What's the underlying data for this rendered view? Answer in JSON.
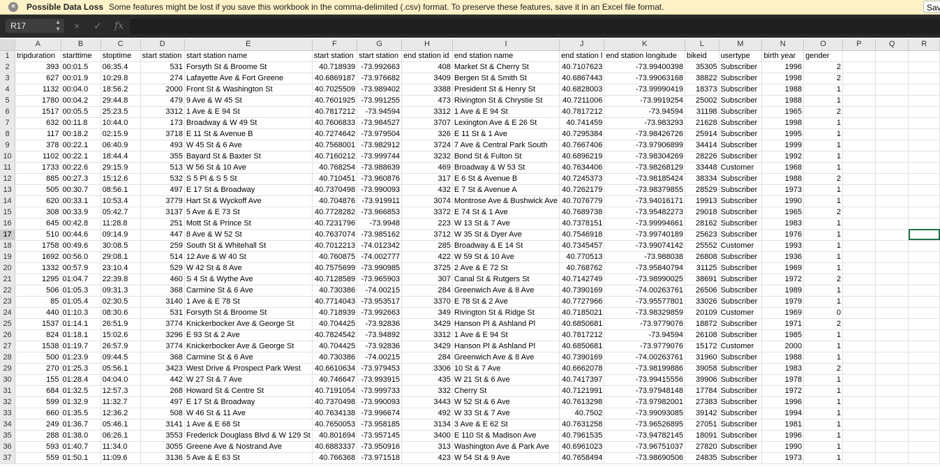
{
  "warning": {
    "icon": "close-circle-icon",
    "title": "Possible Data Loss",
    "message": "Some features might be lost if you save this workbook in the comma-delimited (.csv) format. To preserve these features, save it in an Excel file format.",
    "save_label": "Save As..."
  },
  "formula_bar": {
    "cell_ref": "R17",
    "cancel_icon": "×",
    "confirm_icon": "✓",
    "fx_label": "fx",
    "formula": ""
  },
  "sheet": {
    "selected_cell": "R17",
    "selected_row": "17",
    "columns": [
      "A",
      "B",
      "C",
      "D",
      "E",
      "F",
      "G",
      "H",
      "I",
      "J",
      "K",
      "L",
      "M",
      "N",
      "O",
      "P",
      "Q",
      "R"
    ],
    "rows": [
      [
        "tripduration",
        "starttime",
        "stoptime",
        "start station",
        "start station name",
        "start station",
        "start station",
        "end station id",
        "end station name",
        "end station l",
        "end station longitude",
        "bikeid",
        "usertype",
        "birth year",
        "gender",
        "",
        ""
      ],
      [
        "393",
        "00:01.5",
        "06:35.4",
        "531",
        "Forsyth St & Broome St",
        "40.718939",
        "-73.992663",
        "408",
        "Market St & Cherry St",
        "40.7107623",
        "-73.99400398",
        "35305",
        "Subscriber",
        "1996",
        "2",
        "",
        ""
      ],
      [
        "627",
        "00:01.9",
        "10:29.8",
        "274",
        "Lafayette Ave & Fort Greene",
        "40.6869187",
        "-73.976682",
        "3409",
        "Bergen St & Smith St",
        "40.6867443",
        "-73.99063168",
        "38822",
        "Subscriber",
        "1998",
        "2",
        "",
        ""
      ],
      [
        "1132",
        "00:04.0",
        "18:56.2",
        "2000",
        "Front St & Washington St",
        "40.7025509",
        "-73.989402",
        "3388",
        "President St & Henry St",
        "40.6828003",
        "-73.99990419",
        "18373",
        "Subscriber",
        "1988",
        "1",
        "",
        ""
      ],
      [
        "1780",
        "00:04.2",
        "29:44.8",
        "479",
        "9 Ave & W 45 St",
        "40.7601925",
        "-73.991255",
        "473",
        "Rivington St & Chrystie St",
        "40.7211006",
        "-73.9919254",
        "25002",
        "Subscriber",
        "1988",
        "1",
        "",
        ""
      ],
      [
        "1517",
        "00:05.5",
        "25:23.5",
        "3312",
        "1 Ave & E 94 St",
        "40.7817212",
        "-73.94594",
        "3312",
        "1 Ave & E 94 St",
        "40.7817212",
        "-73.94594",
        "31198",
        "Subscriber",
        "1965",
        "2",
        "",
        ""
      ],
      [
        "632",
        "00:11.8",
        "10:44.0",
        "173",
        "Broadway & W 49 St",
        "40.7606833",
        "-73.984527",
        "3707",
        "Lexington Ave & E 26 St",
        "40.741459",
        "-73.983293",
        "21628",
        "Subscriber",
        "1998",
        "1",
        "",
        ""
      ],
      [
        "117",
        "00:18.2",
        "02:15.9",
        "3718",
        "E 11 St & Avenue B",
        "40.7274642",
        "-73.979504",
        "326",
        "E 11 St & 1 Ave",
        "40.7295384",
        "-73.98426726",
        "25914",
        "Subscriber",
        "1995",
        "1",
        "",
        ""
      ],
      [
        "378",
        "00:22.1",
        "06:40.9",
        "493",
        "W 45 St & 6 Ave",
        "40.7568001",
        "-73.982912",
        "3724",
        "7 Ave & Central Park South",
        "40.7667406",
        "-73.97906899",
        "34414",
        "Subscriber",
        "1999",
        "1",
        "",
        ""
      ],
      [
        "1102",
        "00:22.1",
        "18:44.4",
        "355",
        "Bayard St & Baxter St",
        "40.7160212",
        "-73.999744",
        "3232",
        "Bond St & Fulton St",
        "40.6896219",
        "-73.98304269",
        "28226",
        "Subscriber",
        "1992",
        "1",
        "",
        ""
      ],
      [
        "1733",
        "00:22.6",
        "29:15.9",
        "513",
        "W 56 St & 10 Ave",
        "40.768254",
        "-73.988639",
        "469",
        "Broadway & W 53 St",
        "40.7634406",
        "-73.98268129",
        "33448",
        "Customer",
        "1968",
        "1",
        "",
        ""
      ],
      [
        "885",
        "00:27.3",
        "15:12.6",
        "532",
        "S 5 Pl & S 5 St",
        "40.710451",
        "-73.960876",
        "317",
        "E 6 St & Avenue B",
        "40.7245373",
        "-73.98185424",
        "38334",
        "Subscriber",
        "1988",
        "2",
        "",
        ""
      ],
      [
        "505",
        "00:30.7",
        "08:56.1",
        "497",
        "E 17 St & Broadway",
        "40.7370498",
        "-73.990093",
        "432",
        "E 7 St & Avenue A",
        "40.7262179",
        "-73.98379855",
        "28529",
        "Subscriber",
        "1973",
        "1",
        "",
        ""
      ],
      [
        "620",
        "00:33.1",
        "10:53.4",
        "3779",
        "Hart St & Wyckoff Ave",
        "40.704876",
        "-73.919911",
        "3074",
        "Montrose Ave & Bushwick Ave",
        "40.7076779",
        "-73.94016171",
        "19913",
        "Subscriber",
        "1990",
        "1",
        "",
        ""
      ],
      [
        "308",
        "00:33.9",
        "05:42.7",
        "3137",
        "5 Ave & E 73 St",
        "40.7728282",
        "-73.966853",
        "3372",
        "E 74 St & 1 Ave",
        "40.7689738",
        "-73.95482273",
        "29018",
        "Subscriber",
        "1965",
        "2",
        "",
        ""
      ],
      [
        "645",
        "00:42.8",
        "11:28.8",
        "251",
        "Mott St & Prince St",
        "40.7231796",
        "-73.9948",
        "223",
        "W 13 St & 7 Ave",
        "40.7378151",
        "-73.99994661",
        "28162",
        "Subscriber",
        "1983",
        "1",
        "",
        ""
      ],
      [
        "510",
        "00:44.6",
        "09:14.9",
        "447",
        "8 Ave & W 52 St",
        "40.7637074",
        "-73.985162",
        "3712",
        "W 35 St & Dyer Ave",
        "40.7546918",
        "-73.99740189",
        "25623",
        "Subscriber",
        "1976",
        "1",
        "",
        ""
      ],
      [
        "1758",
        "00:49.6",
        "30:08.5",
        "259",
        "South St & Whitehall St",
        "40.7012213",
        "-74.012342",
        "285",
        "Broadway & E 14 St",
        "40.7345457",
        "-73.99074142",
        "25552",
        "Customer",
        "1993",
        "1",
        "",
        ""
      ],
      [
        "1692",
        "00:56.0",
        "29:08.1",
        "514",
        "12 Ave & W 40 St",
        "40.760875",
        "-74.002777",
        "422",
        "W 59 St & 10 Ave",
        "40.770513",
        "-73.988038",
        "26808",
        "Subscriber",
        "1936",
        "1",
        "",
        ""
      ],
      [
        "1332",
        "00:57.9",
        "23:10.4",
        "529",
        "W 42 St & 8 Ave",
        "40.7575699",
        "-73.990985",
        "3725",
        "2 Ave & E 72 St",
        "40.768762",
        "-73.95840794",
        "31125",
        "Subscriber",
        "1969",
        "1",
        "",
        ""
      ],
      [
        "1295",
        "01:04.7",
        "22:39.8",
        "460",
        "S 4 St & Wythe Ave",
        "40.7128589",
        "-73.965903",
        "307",
        "Canal St & Rutgers St",
        "40.7142749",
        "-73.98990025",
        "38691",
        "Subscriber",
        "1972",
        "2",
        "",
        ""
      ],
      [
        "506",
        "01:05.3",
        "09:31.3",
        "368",
        "Carmine St & 6 Ave",
        "40.730386",
        "-74.00215",
        "284",
        "Greenwich Ave & 8 Ave",
        "40.7390169",
        "-74.00263761",
        "26506",
        "Subscriber",
        "1989",
        "1",
        "",
        ""
      ],
      [
        "85",
        "01:05.4",
        "02:30.5",
        "3140",
        "1 Ave & E 78 St",
        "40.7714043",
        "-73.953517",
        "3370",
        "E 78 St & 2 Ave",
        "40.7727966",
        "-73.95577801",
        "33026",
        "Subscriber",
        "1979",
        "1",
        "",
        ""
      ],
      [
        "440",
        "01:10.3",
        "08:30.6",
        "531",
        "Forsyth St & Broome St",
        "40.718939",
        "-73.992663",
        "349",
        "Rivington St & Ridge St",
        "40.7185021",
        "-73.98329859",
        "20109",
        "Customer",
        "1969",
        "0",
        "",
        ""
      ],
      [
        "1537",
        "01:14.1",
        "26:51.9",
        "3774",
        "Knickerbocker Ave & George St",
        "40.704425",
        "-73.92836",
        "3429",
        "Hanson Pl & Ashland Pl",
        "40.6850681",
        "-73.9779076",
        "18872",
        "Subscriber",
        "1971",
        "2",
        "",
        ""
      ],
      [
        "824",
        "01:18.1",
        "15:02.6",
        "3296",
        "E 93 St & 2 Ave",
        "40.7824542",
        "-73.94892",
        "3312",
        "1 Ave & E 94 St",
        "40.7817212",
        "-73.94594",
        "26108",
        "Subscriber",
        "1985",
        "1",
        "",
        ""
      ],
      [
        "1538",
        "01:19.7",
        "26:57.9",
        "3774",
        "Knickerbocker Ave & George St",
        "40.704425",
        "-73.92836",
        "3429",
        "Hanson Pl & Ashland Pl",
        "40.6850681",
        "-73.9779076",
        "15172",
        "Customer",
        "2000",
        "1",
        "",
        ""
      ],
      [
        "500",
        "01:23.9",
        "09:44.5",
        "368",
        "Carmine St & 6 Ave",
        "40.730386",
        "-74.00215",
        "284",
        "Greenwich Ave & 8 Ave",
        "40.7390169",
        "-74.00263761",
        "31960",
        "Subscriber",
        "1988",
        "1",
        "",
        ""
      ],
      [
        "270",
        "01:25.3",
        "05:56.1",
        "3423",
        "West Drive & Prospect Park West",
        "40.6610634",
        "-73.979453",
        "3306",
        "10 St & 7 Ave",
        "40.6662078",
        "-73.98199886",
        "39058",
        "Subscriber",
        "1983",
        "2",
        "",
        ""
      ],
      [
        "155",
        "01:28.4",
        "04:04.0",
        "442",
        "W 27 St & 7 Ave",
        "40.746647",
        "-73.993915",
        "435",
        "W 21 St & 6 Ave",
        "40.7417397",
        "-73.99415556",
        "39906",
        "Subscriber",
        "1978",
        "1",
        "",
        ""
      ],
      [
        "684",
        "01:32.5",
        "12:57.3",
        "268",
        "Howard St & Centre St",
        "40.7191054",
        "-73.999733",
        "332",
        "Cherry St",
        "40.7121991",
        "-73.97948148",
        "17784",
        "Subscriber",
        "1972",
        "1",
        "",
        ""
      ],
      [
        "599",
        "01:32.9",
        "11:32.7",
        "497",
        "E 17 St & Broadway",
        "40.7370498",
        "-73.990093",
        "3443",
        "W 52 St & 6 Ave",
        "40.7613298",
        "-73.97982001",
        "27383",
        "Subscriber",
        "1996",
        "1",
        "",
        ""
      ],
      [
        "660",
        "01:35.5",
        "12:36.2",
        "508",
        "W 46 St & 11 Ave",
        "40.7634138",
        "-73.996674",
        "492",
        "W 33 St & 7 Ave",
        "40.7502",
        "-73.99093085",
        "39142",
        "Subscriber",
        "1994",
        "1",
        "",
        ""
      ],
      [
        "249",
        "01:36.7",
        "05:46.1",
        "3141",
        "1 Ave & E 68 St",
        "40.7650053",
        "-73.958185",
        "3134",
        "3 Ave & E 62 St",
        "40.7631258",
        "-73.96526895",
        "27051",
        "Subscriber",
        "1981",
        "1",
        "",
        ""
      ],
      [
        "288",
        "01:38.0",
        "06:26.1",
        "3553",
        "Frederick Douglass Blvd & W 129 St",
        "40.801694",
        "-73.957145",
        "3400",
        "E 110 St & Madison Ave",
        "40.7961535",
        "-73.94782145",
        "18091",
        "Subscriber",
        "1996",
        "1",
        "",
        ""
      ],
      [
        "593",
        "01:40.7",
        "11:34.0",
        "3055",
        "Greene Ave & Nostrand Ave",
        "40.6883337",
        "-73.950916",
        "313",
        "Washington Ave & Park Ave",
        "40.6961023",
        "-73.96751037",
        "27820",
        "Subscriber",
        "1990",
        "1",
        "",
        ""
      ],
      [
        "559",
        "01:50.1",
        "11:09.6",
        "3136",
        "5 Ave & E 63 St",
        "40.766368",
        "-73.971518",
        "423",
        "W 54 St & 9 Ave",
        "40.7658494",
        "-73.98690506",
        "24835",
        "Subscriber",
        "1973",
        "1",
        "",
        ""
      ]
    ]
  }
}
